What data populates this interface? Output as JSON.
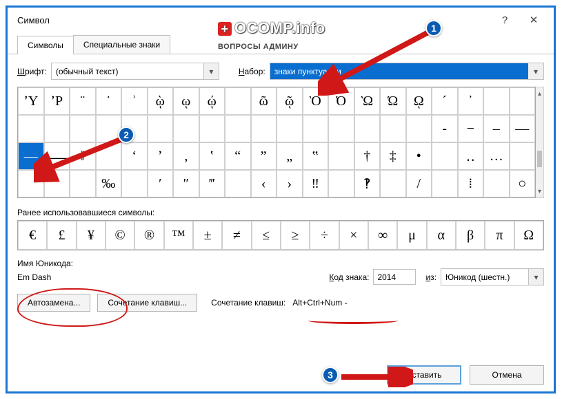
{
  "dialog": {
    "title": "Символ",
    "help": "?",
    "close": "✕"
  },
  "tabs": {
    "symbols": "Символы",
    "special": "Специальные знаки"
  },
  "font": {
    "label": "Шрифт:",
    "value": "(обычный текст)"
  },
  "set": {
    "label": "Набор:",
    "value": "знаки пунктуации"
  },
  "grid": {
    "rows": [
      [
        "ʼY",
        "ʼP",
        "¨",
        "˙",
        "ʾ",
        "ῲ",
        "ῳ",
        "ῴ",
        "",
        "ῶ",
        "ῷ",
        "Ὸ",
        "Ό",
        "Ὼ",
        "Ώ",
        "ῼ",
        "´",
        "᾿",
        " ",
        " "
      ],
      [
        " ",
        " ",
        " ",
        " ",
        " ",
        " ",
        " ",
        " ",
        " ",
        " ",
        " ",
        " ",
        " ",
        " ",
        " ",
        " ",
        "‐",
        "−",
        "–",
        "—"
      ],
      [
        "―",
        "⸺",
        "‖",
        "",
        "ʻ",
        "ʼ",
        "‚",
        "ʽ",
        "“",
        "”",
        "„",
        "‟",
        "",
        "†",
        "‡",
        "•",
        "",
        "‥",
        "…",
        ""
      ],
      [
        "",
        "",
        "",
        "‰",
        "",
        "′",
        "″",
        "‴",
        "",
        "‹",
        "›",
        "‼",
        "",
        "‽",
        "",
        "/",
        "",
        "⁞",
        "",
        "○"
      ]
    ],
    "selected": [
      2,
      0
    ]
  },
  "recent": {
    "label": "Ранее использовавшиеся символы:",
    "items": [
      "€",
      "£",
      "¥",
      "©",
      "®",
      "™",
      "±",
      "≠",
      "≤",
      "≥",
      "÷",
      "×",
      "∞",
      "μ",
      "α",
      "β",
      "π",
      "Ω"
    ]
  },
  "unicode": {
    "name_label": "Имя Юникода:",
    "name_value": "Em Dash",
    "code_label": "Код знака:",
    "code_value": "2014",
    "from_label": "из:",
    "from_value": "Юникод (шестн.)"
  },
  "buttons": {
    "autocorrect": "Автозамена...",
    "shortcut": "Сочетание клавиш...",
    "shortcut_label": "Сочетание клавиш:",
    "shortcut_value": "Alt+Ctrl+Num -",
    "insert": "Вставить",
    "cancel": "Отмена"
  },
  "badges": {
    "one": "1",
    "two": "2",
    "three": "3"
  },
  "watermark": {
    "main": "OCOMP.info",
    "sub": "ВОПРОСЫ АДМИНУ"
  }
}
